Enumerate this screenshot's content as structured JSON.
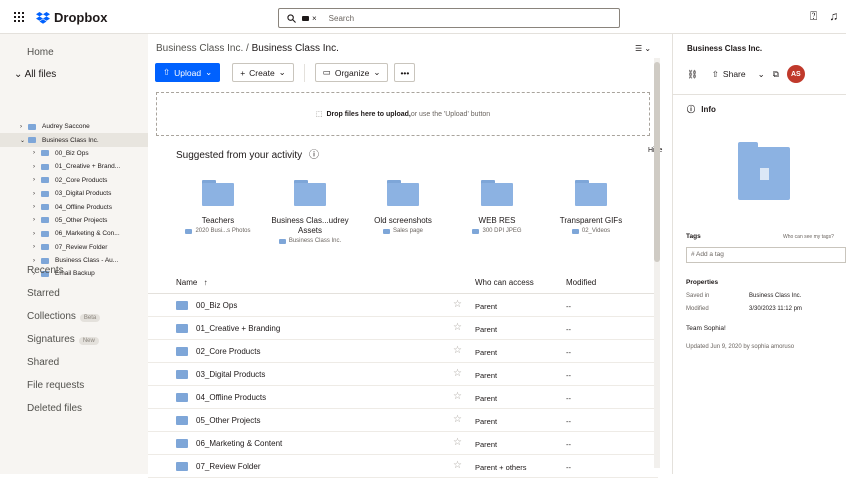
{
  "app": {
    "brand": "Dropbox"
  },
  "search": {
    "chip": "×",
    "placeholder": "Search"
  },
  "sidebar": {
    "home": "Home",
    "all_files": "All files",
    "tree": [
      {
        "label": "Audrey Saccone",
        "level": 1,
        "expanded": false,
        "selected": false
      },
      {
        "label": "Business Class Inc.",
        "level": 1,
        "expanded": true,
        "selected": true
      },
      {
        "label": "00_Biz Ops",
        "level": 2
      },
      {
        "label": "01_Creative + Brand...",
        "level": 2
      },
      {
        "label": "02_Core Products",
        "level": 2
      },
      {
        "label": "03_Digital Products",
        "level": 2
      },
      {
        "label": "04_Offline Products",
        "level": 2
      },
      {
        "label": "05_Other Projects",
        "level": 2
      },
      {
        "label": "06_Marketing & Con...",
        "level": 2
      },
      {
        "label": "07_Review Folder",
        "level": 2
      },
      {
        "label": "Business Class - Au...",
        "level": 2
      },
      {
        "label": "Email Backup",
        "level": 2
      }
    ],
    "recents": "Recents",
    "starred": "Starred",
    "collections": "Collections",
    "collections_badge": "Beta",
    "signatures": "Signatures",
    "signatures_badge": "New",
    "shared": "Shared",
    "file_requests": "File requests",
    "deleted_files": "Deleted files"
  },
  "main": {
    "breadcrumb_parent": "Business Class Inc.",
    "breadcrumb_sep": "/",
    "breadcrumb_current": "Business Class Inc.",
    "toolbar": {
      "upload": "Upload",
      "create": "Create",
      "organize": "Organize",
      "more": "•••"
    },
    "dropzone_bold": "Drop files here to upload,",
    "dropzone_rest": " or use the 'Upload' button",
    "suggest_title": "Suggested from your activity",
    "hide": "Hide",
    "suggestions": [
      {
        "name": "Teachers",
        "sub": "2020 Busi...s Photos"
      },
      {
        "name": "Business Clas...udrey Assets",
        "sub": "Business Class Inc."
      },
      {
        "name": "Old screenshots",
        "sub": "Sales page"
      },
      {
        "name": "WEB RES",
        "sub": "300 DPI JPEG"
      },
      {
        "name": "Transparent GIFs",
        "sub": "02_Videos"
      }
    ],
    "columns": {
      "name": "Name",
      "sort": "↑",
      "access": "Who can access",
      "modified": "Modified"
    },
    "rows": [
      {
        "name": "00_Biz Ops",
        "access": "Parent",
        "modified": "--"
      },
      {
        "name": "01_Creative + Branding",
        "access": "Parent",
        "modified": "--"
      },
      {
        "name": "02_Core Products",
        "access": "Parent",
        "modified": "--"
      },
      {
        "name": "03_Digital Products",
        "access": "Parent",
        "modified": "--"
      },
      {
        "name": "04_Offline Products",
        "access": "Parent",
        "modified": "--"
      },
      {
        "name": "05_Other Projects",
        "access": "Parent",
        "modified": "--"
      },
      {
        "name": "06_Marketing & Content",
        "access": "Parent",
        "modified": "--"
      },
      {
        "name": "07_Review Folder",
        "access": "Parent + others",
        "modified": "--"
      }
    ]
  },
  "rightpanel": {
    "title": "Business Class Inc.",
    "share": "Share",
    "avatar": "AS",
    "info": "Info",
    "tags_label": "Tags",
    "tags_who": "Who can see my tags?",
    "tag_placeholder": "# Add a tag",
    "properties": "Properties",
    "saved_in_label": "Saved in",
    "saved_in_value": "Business Class Inc.",
    "modified_label": "Modified",
    "modified_value": "3/30/2023 11:12 pm",
    "team": "Team Sophia!",
    "updated": "Updated Jun 9, 2020 by sophia amoruso"
  },
  "colors": {
    "accent": "#0061fe",
    "folder": "#7ea6d8",
    "avatar": "#c0392b"
  }
}
